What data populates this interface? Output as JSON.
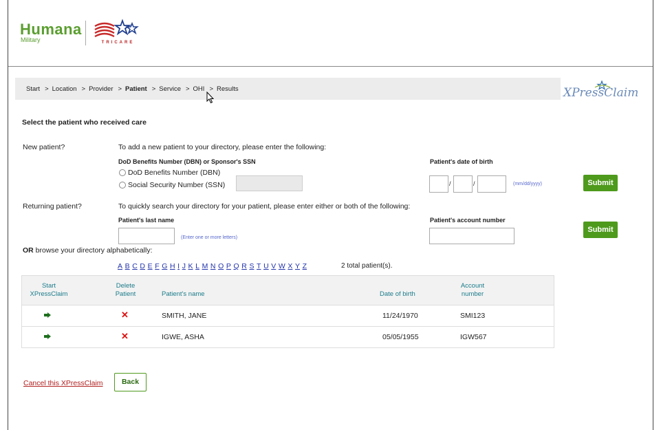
{
  "header": {
    "brand": "Humana",
    "brand_sub": "Military",
    "partner": "TRICARE"
  },
  "breadcrumb": [
    {
      "label": "Start"
    },
    {
      "label": "Location"
    },
    {
      "label": "Provider"
    },
    {
      "label": "Patient",
      "current": true
    },
    {
      "label": "Service"
    },
    {
      "label": "OHI"
    },
    {
      "label": "Results"
    }
  ],
  "breadcrumb_sep": ">",
  "xpress_logo": "XPressClaim",
  "heading": "Select the patient who received care",
  "new_patient": {
    "label": "New patient?",
    "instruction": "To add a new patient to your directory, please enter the following:",
    "id_label": "DoD Benefits Number (DBN) or Sponsor's SSN",
    "option_dbn": "DoD Benefits Number (DBN)",
    "option_ssn": "Social Security Number (SSN)",
    "dob_label": "Patient's date of birth",
    "date_sep": "/",
    "dob_hint": "(mm/dd/yyyy)",
    "submit": "Submit"
  },
  "returning_patient": {
    "label": "Returning patient?",
    "instruction": "To quickly search your directory for your patient, please enter either or both of the following:",
    "last_name_label": "Patient's last name",
    "last_name_hint": "(Enter one or more letters)",
    "account_label": "Patient's account number",
    "submit": "Submit"
  },
  "browse": {
    "or": "OR",
    "text": " browse your directory alphabetically:",
    "letters": [
      "A",
      "B",
      "C",
      "D",
      "E",
      "F",
      "G",
      "H",
      "I",
      "J",
      "K",
      "L",
      "M",
      "N",
      "O",
      "P",
      "Q",
      "R",
      "S",
      "T",
      "U",
      "V",
      "W",
      "X",
      "Y",
      "Z"
    ],
    "total": "2 total patient(s)."
  },
  "table": {
    "headers": {
      "start": "Start XPressClaim",
      "delete": "Delete Patient",
      "name": "Patient's name",
      "dob": "Date of birth",
      "account": "Account number"
    },
    "rows": [
      {
        "name": "SMITH, JANE",
        "dob": "11/24/1970",
        "account": "SMI123"
      },
      {
        "name": "IGWE, ASHA",
        "dob": "05/05/1955",
        "account": "IGW567"
      }
    ]
  },
  "footer": {
    "cancel": "Cancel this XPressClaim",
    "back": "Back"
  },
  "colors": {
    "accent_green": "#4e9a1c",
    "header_teal": "#1a7b8a",
    "link_blue": "#2233aa",
    "cancel_red": "#b02020"
  }
}
